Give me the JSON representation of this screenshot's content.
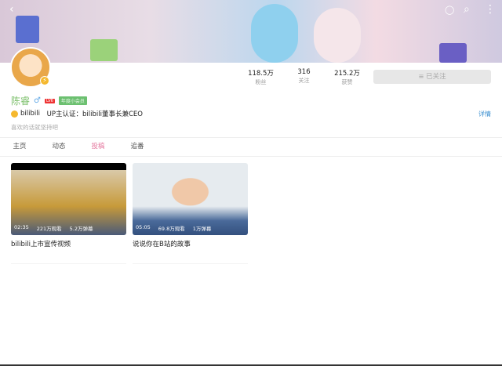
{
  "header": {
    "back_icon": "arrow-left-icon",
    "icons": [
      "message-icon",
      "search-icon",
      "more-icon"
    ]
  },
  "profile": {
    "name": "陈睿",
    "gender": "♂",
    "level": "LV6",
    "vip": "年度小会员",
    "cert_org": "bilibili",
    "cert": "UP主认证：bilibili董事长兼CEO",
    "detail": "详情",
    "sign": "喜欢的话就坚持吧"
  },
  "stats": [
    {
      "value": "118.5万",
      "label": "粉丝"
    },
    {
      "value": "316",
      "label": "关注"
    },
    {
      "value": "215.2万",
      "label": "获赞"
    }
  ],
  "follow_button": "≡ 已关注",
  "tabs": [
    "主页",
    "动态",
    "投稿",
    "追番"
  ],
  "active_tab": "投稿",
  "videos": [
    {
      "duration": "02:35",
      "views": "221万观看",
      "danmaku": "5.2万弹幕",
      "title": "bilibili上市宣传视频"
    },
    {
      "duration": "05:05",
      "views": "69.8万观看",
      "danmaku": "1万弹幕",
      "title": "说说你在B站的故事"
    }
  ]
}
